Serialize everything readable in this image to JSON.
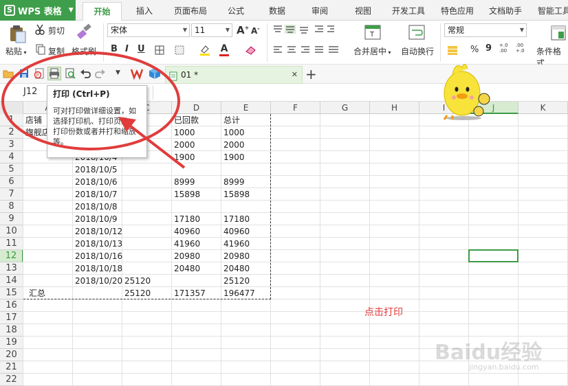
{
  "app": {
    "name": "WPS 表格"
  },
  "tabs": [
    "开始",
    "插入",
    "页面布局",
    "公式",
    "数据",
    "审阅",
    "视图",
    "开发工具",
    "特色应用",
    "文档助手",
    "智能工具"
  ],
  "ribbon": {
    "paste": "粘贴",
    "cut": "剪切",
    "copy": "复制",
    "format_painter": "格式刷",
    "font_name": "宋体",
    "font_size": "11",
    "bold": "B",
    "italic": "I",
    "underline": "U",
    "merge": "合并居中",
    "wrap": "自动换行",
    "number_format": "常规",
    "percent": "%",
    "comma": "9",
    "cond_format": "条件格式",
    "font_grow": "A",
    "font_shrink": "A",
    "font_color_letter": "A",
    "highlight_letter": "ab",
    "dec_plus": "+.0 .00",
    "dec_minus": ".00 +.0"
  },
  "doc_tab": {
    "name": "01 *",
    "close": "✕",
    "add": "+"
  },
  "name_box": "J12",
  "tooltip": {
    "title": "打印 (Ctrl+P)",
    "body": "可对打印做详细设置，如选择打印机、打印页数、打印份数或者并打和缩放等。"
  },
  "columns": [
    "A",
    "B",
    "C",
    "D",
    "E",
    "F",
    "G",
    "H",
    "I",
    "J",
    "K"
  ],
  "rows": [
    "1",
    "2",
    "3",
    "4",
    "5",
    "6",
    "7",
    "8",
    "9",
    "10",
    "11",
    "12",
    "13",
    "14",
    "15",
    "16",
    "17",
    "18",
    "19",
    "20",
    "21",
    "22"
  ],
  "cells": {
    "A1": "店铺",
    "A2": "旗舰店",
    "B1": "日",
    "B4": "2018/10/4",
    "B5": "2018/10/5",
    "B6": "2018/10/6",
    "B7": "2018/10/7",
    "B8": "2018/10/8",
    "B9": "2018/10/9",
    "B10": "2018/10/12",
    "B11": "2018/10/13",
    "B12": "2018/10/16",
    "B13": "2018/10/18",
    "B14": "2018/10/20",
    "C1": "款",
    "C14": "25120",
    "C15": "25120",
    "D1": "已回款",
    "D2": "1000",
    "D3": "2000",
    "D4": "1900",
    "D6": "8999",
    "D7": "15898",
    "D9": "17180",
    "D10": "40960",
    "D11": "41960",
    "D12": "20980",
    "D13": "20480",
    "D15": "171357",
    "E1": "总计",
    "E2": "1000",
    "E3": "2000",
    "E4": "1900",
    "E6": "8999",
    "E7": "15898",
    "E9": "17180",
    "E10": "40960",
    "E11": "41960",
    "E12": "20980",
    "E13": "20480",
    "E14": "25120",
    "E15": "196477",
    "A15": "汇总"
  },
  "annotation": "点击打印",
  "watermark": {
    "text": "Baidu经验",
    "sub": "jingyan.baidu.com"
  },
  "colors": {
    "accent_green": "#3f9e4b",
    "annotation_red": "#e03c3c",
    "selection_green": "#3c9a46"
  }
}
